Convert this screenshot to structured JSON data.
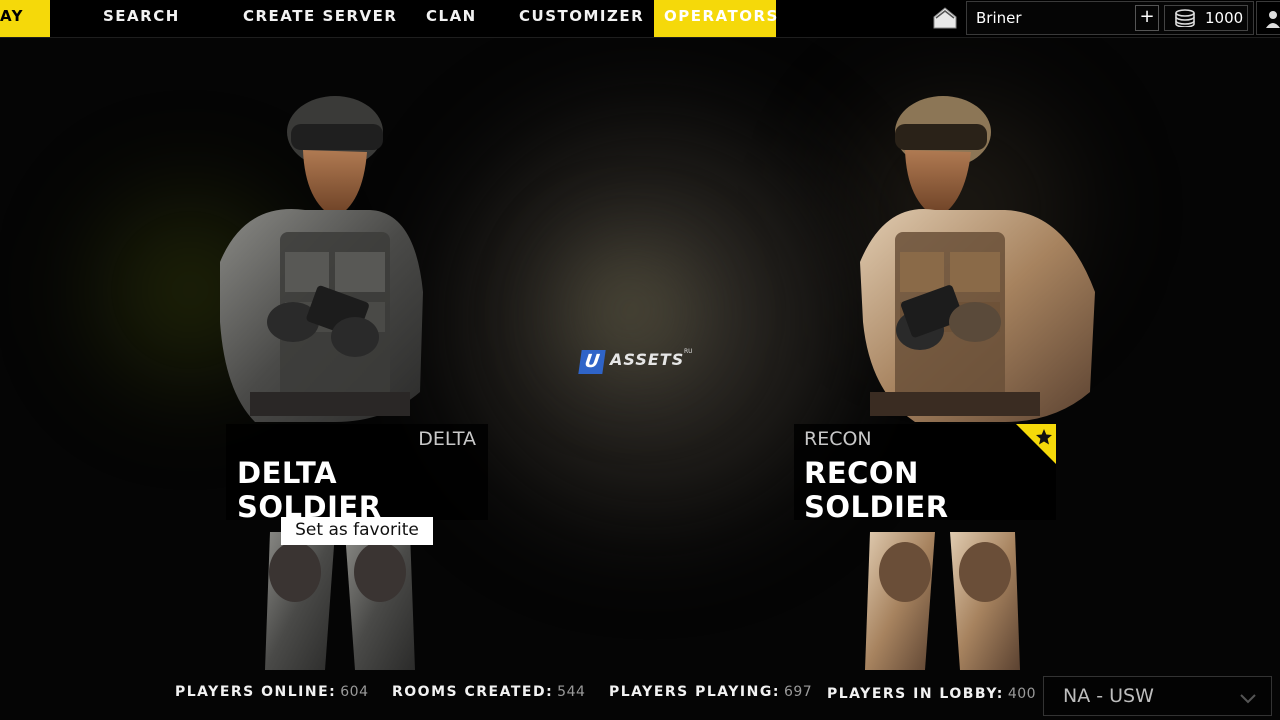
{
  "nav": {
    "play_label": "AY",
    "search_label": "SEARCH",
    "create_server_label": "CREATE SERVER",
    "clan_label": "CLAN",
    "customizer_label": "CUSTOMIZER",
    "operators_label": "OPERATORS",
    "active_tab": "OPERATORS",
    "accent_color": "#f5d90a"
  },
  "user": {
    "name": "Briner",
    "coins": "1000",
    "home_icon": "home-icon",
    "coin_icon": "coin-stack-icon",
    "add_icon": "plus-icon"
  },
  "operators": [
    {
      "class": "DELTA",
      "name": "DELTA SOLDIER",
      "favorite": false
    },
    {
      "class": "RECON",
      "name": "RECON SOLDIER",
      "favorite": true
    }
  ],
  "favorite_button_label": "Set as favorite",
  "watermark": {
    "letter": "U",
    "text": "ASSETS",
    "suffix": "RU"
  },
  "stats": {
    "players_online_label": "PLAYERS ONLINE:",
    "players_online": "604",
    "rooms_created_label": "ROOMS CREATED:",
    "rooms_created": "544",
    "players_playing_label": "PLAYERS PLAYING:",
    "players_playing": "697",
    "players_in_lobby_label": "PLAYERS IN LOBBY:",
    "players_in_lobby": "400"
  },
  "region": {
    "selected": "NA - USW"
  }
}
